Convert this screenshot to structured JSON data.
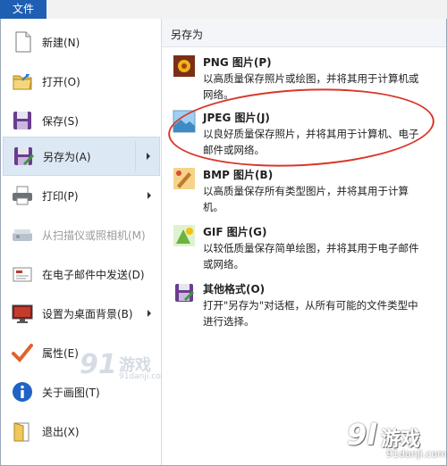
{
  "topbar": {
    "file_tab": "文件"
  },
  "left_menu": {
    "items": [
      {
        "label": "新建(N)",
        "icon": "new-doc-icon"
      },
      {
        "label": "打开(O)",
        "icon": "folder-icon"
      },
      {
        "label": "保存(S)",
        "icon": "save-icon"
      },
      {
        "label": "另存为(A)",
        "icon": "save-as-icon"
      },
      {
        "label": "打印(P)",
        "icon": "printer-icon"
      },
      {
        "label": "从扫描仪或照相机(M)",
        "icon": "scanner-icon"
      },
      {
        "label": "在电子邮件中发送(D)",
        "icon": "email-icon"
      },
      {
        "label": "设置为桌面背景(B)",
        "icon": "desktop-icon"
      },
      {
        "label": "属性(E)",
        "icon": "checkmark-icon"
      },
      {
        "label": "关于画图(T)",
        "icon": "info-icon"
      },
      {
        "label": "退出(X)",
        "icon": "exit-icon"
      }
    ]
  },
  "save_as_panel": {
    "header": "另存为",
    "items": [
      {
        "title": "PNG 图片(P)",
        "desc": "以高质量保存照片或绘图，并将其用于计算机或网络。",
        "icon": "png-flower-icon"
      },
      {
        "title": "JPEG 图片(J)",
        "desc": "以良好质量保存照片，并将其用于计算机、电子邮件或网络。",
        "icon": "jpeg-landscape-icon"
      },
      {
        "title": "BMP 图片(B)",
        "desc": "以高质量保存所有类型图片，并将其用于计算机。",
        "icon": "bmp-paint-icon"
      },
      {
        "title": "GIF 图片(G)",
        "desc": "以较低质量保存简单绘图，并将其用于电子邮件或网络。",
        "icon": "gif-shapes-icon"
      },
      {
        "title": "其他格式(O)",
        "desc": "打开\"另存为\"对话框，从所有可能的文件类型中进行选择。",
        "icon": "other-format-icon"
      }
    ]
  },
  "watermark": {
    "mark1_num": "91",
    "mark1_text": "游戏",
    "mark1_url": "91danji.com",
    "mark2_num": "9l",
    "mark2_text": "游戏",
    "mark2_url": "91danji.com"
  },
  "colors": {
    "file_tab": "#1e5fb3",
    "selected_bg": "#dde8f5",
    "highlight": "#d9372a"
  }
}
